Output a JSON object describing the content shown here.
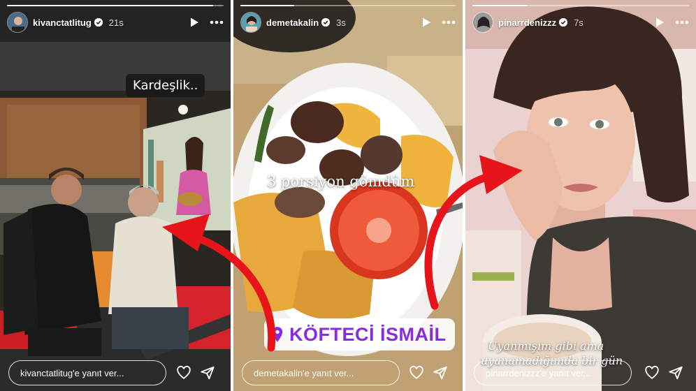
{
  "stories": [
    {
      "username": "kivanctatlitug",
      "time": "21s",
      "reply_placeholder": "kivanctatlitug'e yanıt ver...",
      "progress": 0.95,
      "sticker_text": "Kardeşlik.."
    },
    {
      "username": "demetakalin",
      "time": "3s",
      "reply_placeholder": "demetakalin'e yanıt ver...",
      "progress": 0.25,
      "overlay_text": "3 porsiyon gömdüm",
      "location": "KÖFTECİ İSMAİL"
    },
    {
      "username": "pinarrdenizzz",
      "time": "7s",
      "reply_placeholder": "pinarrdenizzz'e yanıt ver...",
      "progress": 0.25,
      "caption_line1": "Uyanmışım gibi ama",
      "caption_line2": "uyanamadığımda bir gün"
    }
  ],
  "icons": {
    "verified": "verified-badge-icon",
    "play": "play-icon",
    "more": "more-dots-icon",
    "heart": "heart-icon",
    "send": "send-icon",
    "location": "location-pin-icon"
  },
  "colors": {
    "arrow": "#e8141b",
    "location_text": "#8a2be2"
  }
}
